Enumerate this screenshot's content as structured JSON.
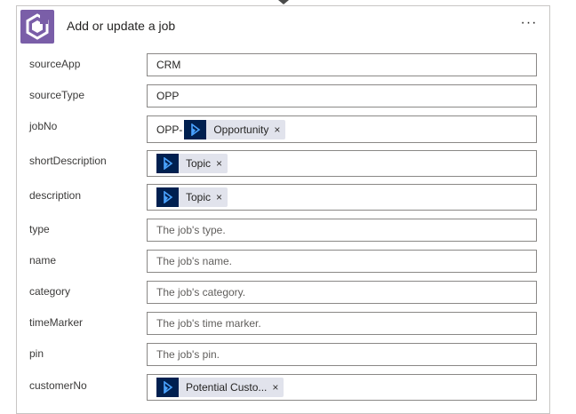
{
  "card": {
    "title": "Add or update a job",
    "more_label": "···"
  },
  "fields": [
    {
      "label": "sourceApp",
      "value": "CRM"
    },
    {
      "label": "sourceType",
      "value": "OPP"
    },
    {
      "label": "jobNo",
      "prefix": "OPP-",
      "token": "Opportunity"
    },
    {
      "label": "shortDescription",
      "token": "Topic"
    },
    {
      "label": "description",
      "token": "Topic"
    },
    {
      "label": "type",
      "placeholder": "The job's type."
    },
    {
      "label": "name",
      "placeholder": "The job's name."
    },
    {
      "label": "category",
      "placeholder": "The job's category."
    },
    {
      "label": "timeMarker",
      "placeholder": "The job's time marker."
    },
    {
      "label": "pin",
      "placeholder": "The job's pin."
    },
    {
      "label": "customerNo",
      "token": "Potential Custo..."
    }
  ],
  "token_close": "×",
  "colors": {
    "logo_bg": "#7a5ea8",
    "token_bg": "#e1e3ec",
    "token_icon_bg": "#002050"
  },
  "icons": {
    "app": "connector-logo-icon",
    "token": "dynamics-icon"
  }
}
